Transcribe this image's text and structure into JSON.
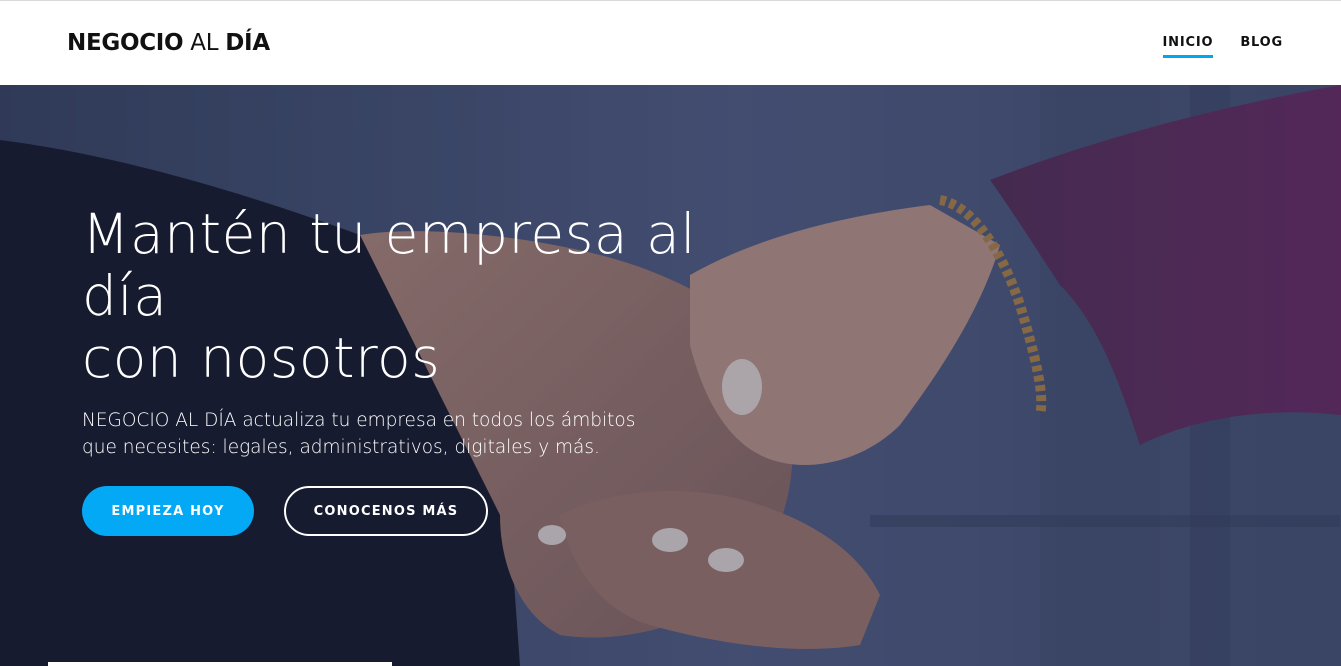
{
  "header": {
    "brand": {
      "part1": "NEGOCIO",
      "part2": "AL",
      "part3": "DÍA"
    },
    "nav": [
      {
        "label": "INICIO",
        "active": true
      },
      {
        "label": "BLOG",
        "active": false
      }
    ],
    "accent_color": "#00a6f0"
  },
  "hero": {
    "title_lines": [
      "Mantén tu empresa al",
      "día",
      "con nosotros"
    ],
    "description_lines": [
      "NEGOCIO AL DÍA actualiza tu empresa en todos los ámbitos",
      "que necesites: legales, administrativos, digitales y más."
    ],
    "primary_button": "EMPIEZA HOY",
    "secondary_button": "CONOCENOS MÁS",
    "background_image": "handshake-photo",
    "primary_color": "#03a9f4"
  }
}
